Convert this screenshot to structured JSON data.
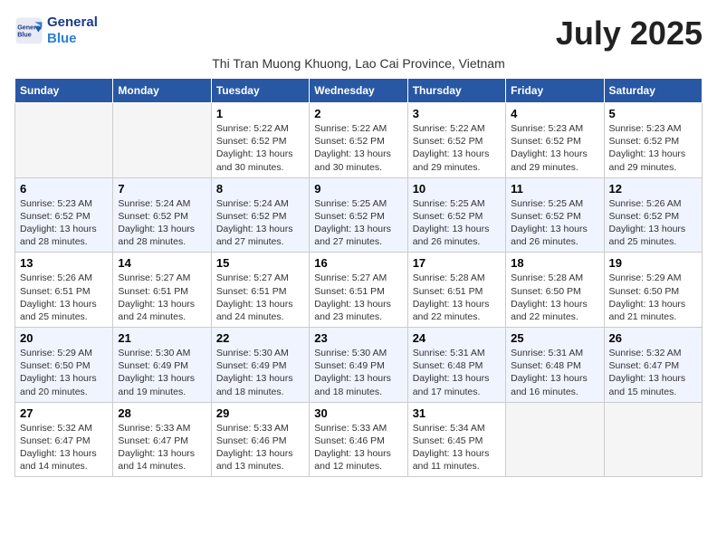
{
  "header": {
    "logo_line1": "General",
    "logo_line2": "Blue",
    "month_title": "July 2025",
    "subtitle": "Thi Tran Muong Khuong, Lao Cai Province, Vietnam"
  },
  "weekdays": [
    "Sunday",
    "Monday",
    "Tuesday",
    "Wednesday",
    "Thursday",
    "Friday",
    "Saturday"
  ],
  "weeks": [
    [
      {
        "day": "",
        "info": ""
      },
      {
        "day": "",
        "info": ""
      },
      {
        "day": "1",
        "info": "Sunrise: 5:22 AM\nSunset: 6:52 PM\nDaylight: 13 hours\nand 30 minutes."
      },
      {
        "day": "2",
        "info": "Sunrise: 5:22 AM\nSunset: 6:52 PM\nDaylight: 13 hours\nand 30 minutes."
      },
      {
        "day": "3",
        "info": "Sunrise: 5:22 AM\nSunset: 6:52 PM\nDaylight: 13 hours\nand 29 minutes."
      },
      {
        "day": "4",
        "info": "Sunrise: 5:23 AM\nSunset: 6:52 PM\nDaylight: 13 hours\nand 29 minutes."
      },
      {
        "day": "5",
        "info": "Sunrise: 5:23 AM\nSunset: 6:52 PM\nDaylight: 13 hours\nand 29 minutes."
      }
    ],
    [
      {
        "day": "6",
        "info": "Sunrise: 5:23 AM\nSunset: 6:52 PM\nDaylight: 13 hours\nand 28 minutes."
      },
      {
        "day": "7",
        "info": "Sunrise: 5:24 AM\nSunset: 6:52 PM\nDaylight: 13 hours\nand 28 minutes."
      },
      {
        "day": "8",
        "info": "Sunrise: 5:24 AM\nSunset: 6:52 PM\nDaylight: 13 hours\nand 27 minutes."
      },
      {
        "day": "9",
        "info": "Sunrise: 5:25 AM\nSunset: 6:52 PM\nDaylight: 13 hours\nand 27 minutes."
      },
      {
        "day": "10",
        "info": "Sunrise: 5:25 AM\nSunset: 6:52 PM\nDaylight: 13 hours\nand 26 minutes."
      },
      {
        "day": "11",
        "info": "Sunrise: 5:25 AM\nSunset: 6:52 PM\nDaylight: 13 hours\nand 26 minutes."
      },
      {
        "day": "12",
        "info": "Sunrise: 5:26 AM\nSunset: 6:52 PM\nDaylight: 13 hours\nand 25 minutes."
      }
    ],
    [
      {
        "day": "13",
        "info": "Sunrise: 5:26 AM\nSunset: 6:51 PM\nDaylight: 13 hours\nand 25 minutes."
      },
      {
        "day": "14",
        "info": "Sunrise: 5:27 AM\nSunset: 6:51 PM\nDaylight: 13 hours\nand 24 minutes."
      },
      {
        "day": "15",
        "info": "Sunrise: 5:27 AM\nSunset: 6:51 PM\nDaylight: 13 hours\nand 24 minutes."
      },
      {
        "day": "16",
        "info": "Sunrise: 5:27 AM\nSunset: 6:51 PM\nDaylight: 13 hours\nand 23 minutes."
      },
      {
        "day": "17",
        "info": "Sunrise: 5:28 AM\nSunset: 6:51 PM\nDaylight: 13 hours\nand 22 minutes."
      },
      {
        "day": "18",
        "info": "Sunrise: 5:28 AM\nSunset: 6:50 PM\nDaylight: 13 hours\nand 22 minutes."
      },
      {
        "day": "19",
        "info": "Sunrise: 5:29 AM\nSunset: 6:50 PM\nDaylight: 13 hours\nand 21 minutes."
      }
    ],
    [
      {
        "day": "20",
        "info": "Sunrise: 5:29 AM\nSunset: 6:50 PM\nDaylight: 13 hours\nand 20 minutes."
      },
      {
        "day": "21",
        "info": "Sunrise: 5:30 AM\nSunset: 6:49 PM\nDaylight: 13 hours\nand 19 minutes."
      },
      {
        "day": "22",
        "info": "Sunrise: 5:30 AM\nSunset: 6:49 PM\nDaylight: 13 hours\nand 18 minutes."
      },
      {
        "day": "23",
        "info": "Sunrise: 5:30 AM\nSunset: 6:49 PM\nDaylight: 13 hours\nand 18 minutes."
      },
      {
        "day": "24",
        "info": "Sunrise: 5:31 AM\nSunset: 6:48 PM\nDaylight: 13 hours\nand 17 minutes."
      },
      {
        "day": "25",
        "info": "Sunrise: 5:31 AM\nSunset: 6:48 PM\nDaylight: 13 hours\nand 16 minutes."
      },
      {
        "day": "26",
        "info": "Sunrise: 5:32 AM\nSunset: 6:47 PM\nDaylight: 13 hours\nand 15 minutes."
      }
    ],
    [
      {
        "day": "27",
        "info": "Sunrise: 5:32 AM\nSunset: 6:47 PM\nDaylight: 13 hours\nand 14 minutes."
      },
      {
        "day": "28",
        "info": "Sunrise: 5:33 AM\nSunset: 6:47 PM\nDaylight: 13 hours\nand 14 minutes."
      },
      {
        "day": "29",
        "info": "Sunrise: 5:33 AM\nSunset: 6:46 PM\nDaylight: 13 hours\nand 13 minutes."
      },
      {
        "day": "30",
        "info": "Sunrise: 5:33 AM\nSunset: 6:46 PM\nDaylight: 13 hours\nand 12 minutes."
      },
      {
        "day": "31",
        "info": "Sunrise: 5:34 AM\nSunset: 6:45 PM\nDaylight: 13 hours\nand 11 minutes."
      },
      {
        "day": "",
        "info": ""
      },
      {
        "day": "",
        "info": ""
      }
    ]
  ]
}
